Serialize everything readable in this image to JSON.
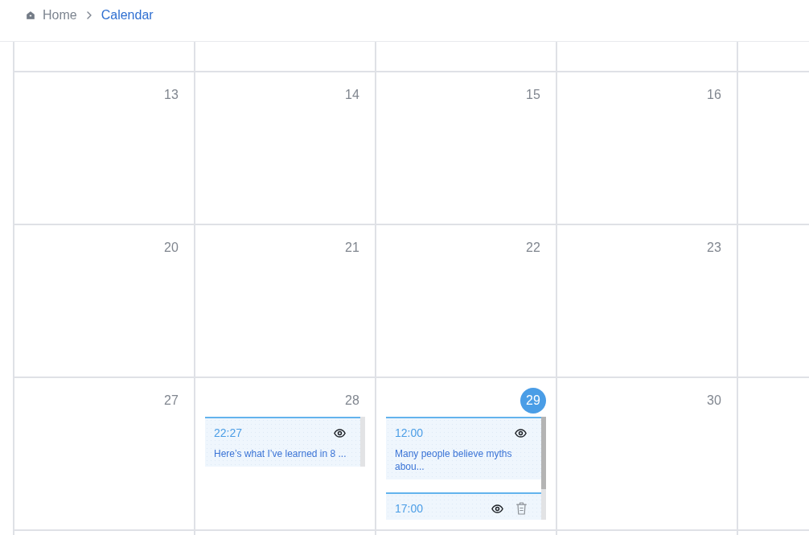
{
  "breadcrumb": [
    {
      "label": "Home",
      "current": false
    },
    {
      "label": "Calendar",
      "current": true
    }
  ],
  "calendar": {
    "weeks": [
      {
        "days": [
          {
            "number": "13"
          },
          {
            "number": "14"
          },
          {
            "number": "15"
          },
          {
            "number": "16"
          }
        ]
      },
      {
        "days": [
          {
            "number": "20"
          },
          {
            "number": "21"
          },
          {
            "number": "22"
          },
          {
            "number": "23"
          }
        ]
      },
      {
        "days": [
          {
            "number": "27"
          },
          {
            "number": "28",
            "events": [
              {
                "time": "22:27",
                "text": "Here’s what I’ve learned in 8 ...",
                "actions": [
                  {
                    "kind": "view"
                  }
                ]
              }
            ]
          },
          {
            "number": "29",
            "today": true,
            "events": [
              {
                "time": "12:00",
                "text": "Many people believe myths abou...",
                "actions": [
                  {
                    "kind": "view"
                  }
                ]
              },
              {
                "time": "17:00",
                "actions": [
                  {
                    "kind": "view"
                  },
                  {
                    "kind": "delete"
                  }
                ]
              }
            ]
          },
          {
            "number": "30"
          }
        ]
      }
    ]
  }
}
